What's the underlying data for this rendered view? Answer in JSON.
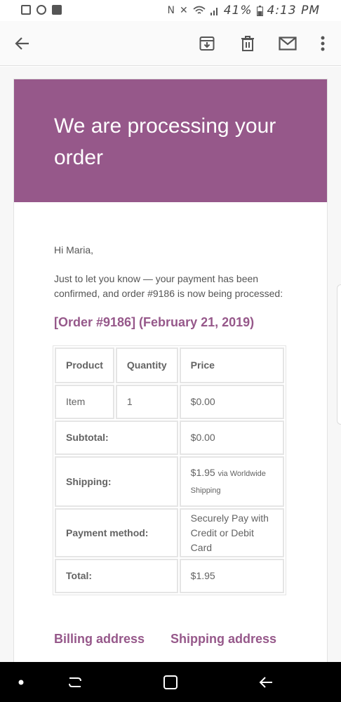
{
  "status_bar": {
    "time": "4:13 PM",
    "battery": "41%",
    "left_icons": [
      "image-icon",
      "circle-icon",
      "facebook-icon"
    ],
    "right_icons": [
      "nfc-icon",
      "mute-icon",
      "wifi-icon",
      "signal-icon",
      "battery-icon"
    ]
  },
  "action_bar": {
    "icons": [
      "back-arrow-icon",
      "archive-icon",
      "delete-icon",
      "mail-icon",
      "more-vert-icon"
    ]
  },
  "email": {
    "header_title": "We are processing your order",
    "greeting": "Hi Maria,",
    "intro": "Just to let you know — your payment has been confirmed, and order #9186 is now being processed:",
    "order_heading": "[Order #9186] (February 21, 2019)",
    "table": {
      "headers": {
        "product": "Product",
        "quantity": "Quantity",
        "price": "Price"
      },
      "item": {
        "product": "Item",
        "quantity": "1",
        "price": "$0.00"
      },
      "subtotal": {
        "label": "Subtotal:",
        "value": "$0.00"
      },
      "shipping": {
        "label": "Shipping:",
        "value": "$1.95",
        "via": "via Worldwide Shipping"
      },
      "payment": {
        "label": "Payment method:",
        "value": "Securely Pay with Credit or Debit Card"
      },
      "total": {
        "label": "Total:",
        "value": "$1.95"
      }
    },
    "billing_title": "Billing address",
    "shipping_title": "Shipping address"
  },
  "colors": {
    "brand": "#96588a",
    "text": "#636363",
    "border": "#e5e5e5"
  },
  "nav_bar": {
    "icons": [
      "dot-icon",
      "recents-icon",
      "home-icon",
      "back-icon"
    ]
  }
}
